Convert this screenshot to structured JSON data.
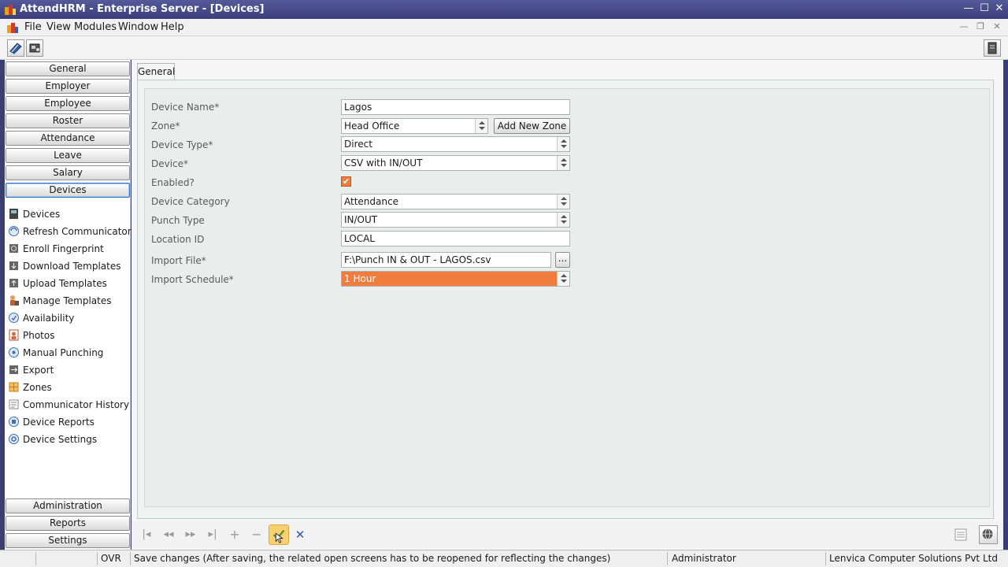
{
  "window": {
    "title": "AttendHRM - Enterprise Server - [Devices]"
  },
  "menu": [
    "File",
    "View",
    "Modules",
    "Window",
    "Help"
  ],
  "nav_top": [
    "General",
    "Employer",
    "Employee",
    "Roster",
    "Attendance",
    "Leave",
    "Salary",
    "Devices"
  ],
  "nav_active": "Devices",
  "device_links": [
    {
      "label": "Devices",
      "icon": "device-icon"
    },
    {
      "label": "Refresh Communicator",
      "icon": "refresh-icon"
    },
    {
      "label": "Enroll Fingerprint",
      "icon": "fingerprint-icon"
    },
    {
      "label": "Download Templates",
      "icon": "download-icon"
    },
    {
      "label": "Upload Templates",
      "icon": "upload-icon"
    },
    {
      "label": "Manage Templates",
      "icon": "manage-templates-icon"
    },
    {
      "label": "Availability",
      "icon": "availability-icon"
    },
    {
      "label": "Photos",
      "icon": "photo-icon"
    },
    {
      "label": "Manual Punching",
      "icon": "manual-punch-icon"
    },
    {
      "label": "Export",
      "icon": "export-icon"
    },
    {
      "label": "Zones",
      "icon": "zones-icon"
    },
    {
      "label": "Communicator History",
      "icon": "history-icon"
    },
    {
      "label": "Device Reports",
      "icon": "report-icon"
    },
    {
      "label": "Device Settings",
      "icon": "settings-icon"
    }
  ],
  "nav_bottom": [
    "Administration",
    "Reports",
    "Settings"
  ],
  "tab": "General",
  "form": {
    "device_name_label": "Device Name*",
    "device_name_value": "Lagos",
    "zone_label": "Zone*",
    "zone_value": "Head Office",
    "add_zone_label": "Add New Zone",
    "device_type_label": "Device Type*",
    "device_type_value": "Direct",
    "device_label": "Device*",
    "device_value": "CSV with IN/OUT",
    "enabled_label": "Enabled?",
    "enabled_mark": "✔",
    "category_label": "Device Category",
    "category_value": "Attendance",
    "punch_type_label": "Punch Type",
    "punch_type_value": "IN/OUT",
    "location_label": "Location ID",
    "location_value": "LOCAL",
    "import_file_label": "Import File*",
    "import_file_value": "F:\\Punch IN & OUT - LAGOS.csv",
    "browse_label": "...",
    "schedule_label": "Import Schedule*",
    "schedule_value": "1 Hour"
  },
  "status": {
    "mode": "OVR",
    "message": "Save changes (After saving, the related open screens has to be reopened for reflecting the changes)",
    "user": "Administrator",
    "company": "Lenvica Computer Solutions Pvt Ltd"
  },
  "colors": {
    "accent_orange": "#f07c3e",
    "title_bar": "#3a3f7a"
  }
}
